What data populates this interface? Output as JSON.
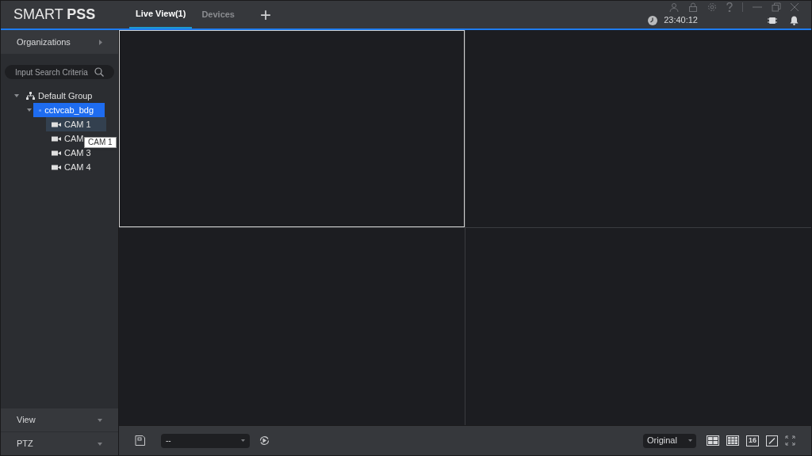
{
  "header": {
    "logo": "SMART **PSS**",
    "tabs": [
      {
        "label": "Live View(1)",
        "selected": true
      },
      {
        "label": "Devices",
        "selected": false
      }
    ],
    "add_tab": "+",
    "time": "23:40:12"
  },
  "sidebar": {
    "organizations": "Organizations",
    "search": {
      "placeholder": "Input Search Criteria"
    },
    "tree": [
      {
        "kind": "group",
        "label": "Default Group",
        "expanded": true,
        "selected": false,
        "children": [
          {
            "kind": "device",
            "label": "cctvcab_bdg",
            "expanded": true,
            "selected": true,
            "children": [
              {
                "kind": "camera",
                "label": "CAM 1",
                "selected": false,
                "hovered": true
              },
              {
                "kind": "camera",
                "label": "CAM",
                "selected": false,
                "hovered": false
              },
              {
                "kind": "camera",
                "label": "CAM 3",
                "selected": false,
                "hovered": false
              },
              {
                "kind": "camera",
                "label": "CAM 4",
                "selected": false,
                "hovered": false
              }
            ]
          }
        ]
      }
    ],
    "tooltip": "CAM 1",
    "panels": [
      "View",
      "PTZ"
    ]
  },
  "video_panes": [
    {
      "selected": true
    },
    {
      "selected": false
    },
    {
      "selected": false
    },
    {
      "selected": false
    }
  ],
  "toolbar": {
    "view_select": "--",
    "stream_select": "Original",
    "grid_16": "16"
  }
}
